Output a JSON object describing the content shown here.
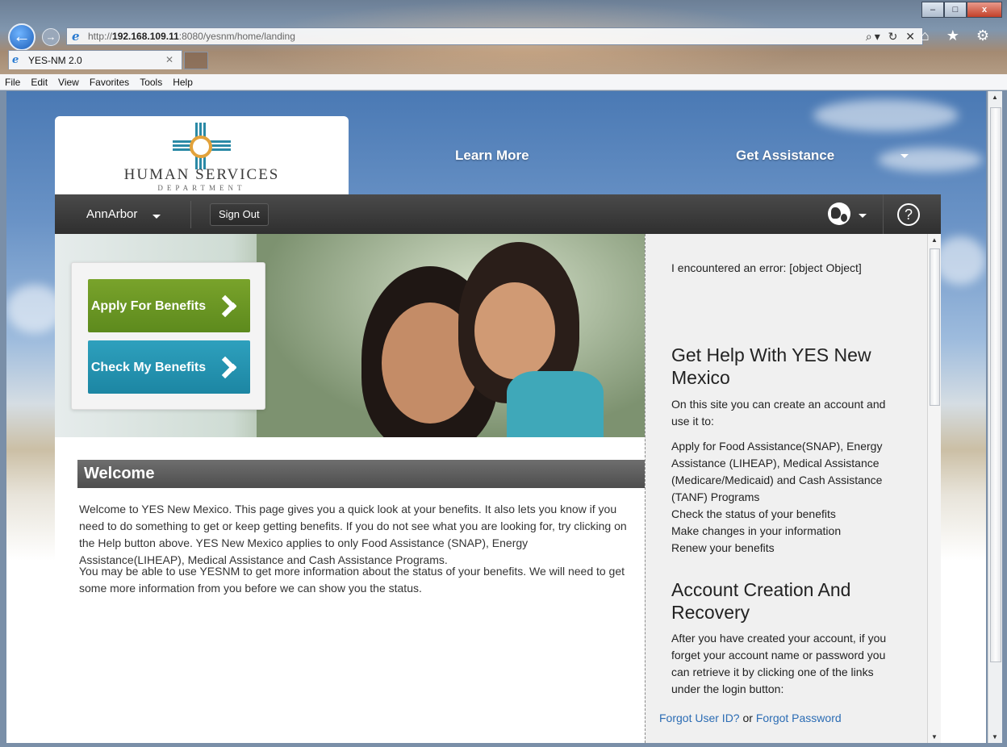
{
  "browser": {
    "url_prefix": "http://",
    "url_host": "192.168.109.11",
    "url_rest": ":8080/yesnm/home/landing",
    "address_tools": "⌕▾ ↻ ✕",
    "tab_title": "YES-NM 2.0",
    "tab_close": "✕",
    "back_icon": "←",
    "forward_icon": "→",
    "right_icons": "⌂ ★ ⚙",
    "window_buttons": {
      "minimize": "–",
      "maximize": "□",
      "close": "x"
    },
    "menu": [
      "File",
      "Edit",
      "View",
      "Favorites",
      "Tools",
      "Help"
    ]
  },
  "header": {
    "logo_title": "HUMAN SERVICES",
    "logo_subtitle": "DEPARTMENT",
    "nav_learn_more": "Learn More",
    "nav_get_assistance": "Get Assistance"
  },
  "userbar": {
    "username": "AnnArbor",
    "sign_out": "Sign Out",
    "help": "?"
  },
  "hero": {
    "apply_label": "Apply For Benefits",
    "check_label": "Check My Benefits"
  },
  "main": {
    "welcome_title": "Welcome",
    "para1": "Welcome to YES New Mexico. This page gives you a quick look at your benefits. It also lets you know if you need to do something to get or keep getting benefits. If you do not see what you are looking for, try clicking on the Help button above. YES New Mexico applies to only Food Assistance (SNAP), Energy Assistance(LIHEAP), Medical Assistance and Cash Assistance Programs.",
    "para2": "You may be able to use YESNM to get more information about the status of your benefits. We will need to get some more information from you before we can show you the status."
  },
  "sidebar": {
    "error": "I encountered an error: [object Object]",
    "help_title": "Get Help With YES New Mexico",
    "help_intro": "On this site you can create an account and use it to:",
    "help_items": [
      "Apply for Food Assistance(SNAP), Energy Assistance (LIHEAP), Medical Assistance (Medicare/Medicaid) and Cash Assistance (TANF) Programs",
      "Check the status of your benefits",
      "Make changes in your information",
      "Renew your benefits"
    ],
    "account_title": "Account Creation And Recovery",
    "account_text": "After you have created your account, if you forget your account name or password you can retrieve it by clicking one of the links under the login button:",
    "forgot_user": "Forgot User ID?",
    "or_text": " or ",
    "forgot_password": "Forgot Password"
  }
}
